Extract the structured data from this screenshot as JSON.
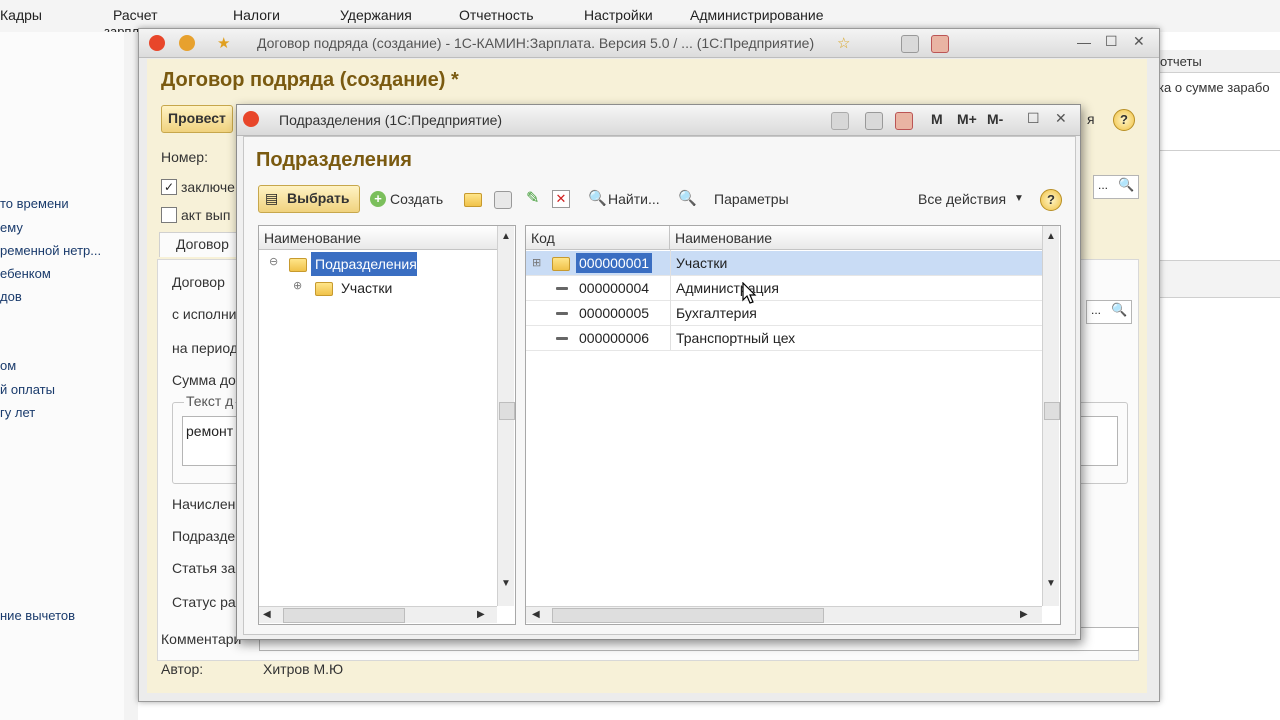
{
  "main_menu": [
    "Кадры",
    "Расчет",
    "зарпл",
    "Налоги",
    "Удержания",
    "Отчетность",
    "Настройки",
    "Администрирование"
  ],
  "left_panel": [
    "то времени",
    "ему",
    "ременной нетр...",
    "ебенком",
    "дов",
    "ом",
    "й оплаты",
    "гу лет",
    "ние вычетов"
  ],
  "right_panel": {
    "header": "отчеты",
    "item": "ка о сумме зарабо"
  },
  "contract_window": {
    "title": "Договор подряда (создание) - 1С-КАМИН:Зарплата. Версия 5.0 / ...  (1С:Предприятие)",
    "heading": "Договор подряда (создание) *",
    "post_button": "Провест",
    "number_label": "Номер:",
    "concluded_label": "заключе",
    "act_label": "акт вып",
    "tab_label": "Договор",
    "contract_label": "Договор",
    "executor_label": "с исполни",
    "period_label": "на период",
    "sum_label": "Сумма до",
    "text_group_label": "Текст д",
    "text_value": "ремонт",
    "accrual_label": "Начислен",
    "dept_label": "Подразде",
    "article_label": "Статья за",
    "status_label": "Статус ра",
    "comment_label": "Комментари",
    "author_label": "Автор:",
    "author_value": "Хитров М.Ю",
    "more_suffix": "я"
  },
  "modal": {
    "title": "Подразделения  (1С:Предприятие)",
    "heading": "Подразделения",
    "toolbar": {
      "select": "Выбрать",
      "create": "Создать",
      "find": "Найти...",
      "params": "Параметры",
      "all_actions": "Все действия"
    },
    "tree": {
      "header": "Наименование",
      "root": "Подразделения",
      "child": "Участки"
    },
    "list": {
      "col_code": "Код",
      "col_name": "Наименование",
      "rows": [
        {
          "code": "000000001",
          "name": "Участки"
        },
        {
          "code": "000000004",
          "name": "Администрация"
        },
        {
          "code": "000000005",
          "name": "Бухгалтерия"
        },
        {
          "code": "000000006",
          "name": "Транспортный цех"
        }
      ]
    }
  },
  "colors": {
    "accent": "#f0c040",
    "selection": "#c9dcf5",
    "heading": "#7a5a10"
  }
}
